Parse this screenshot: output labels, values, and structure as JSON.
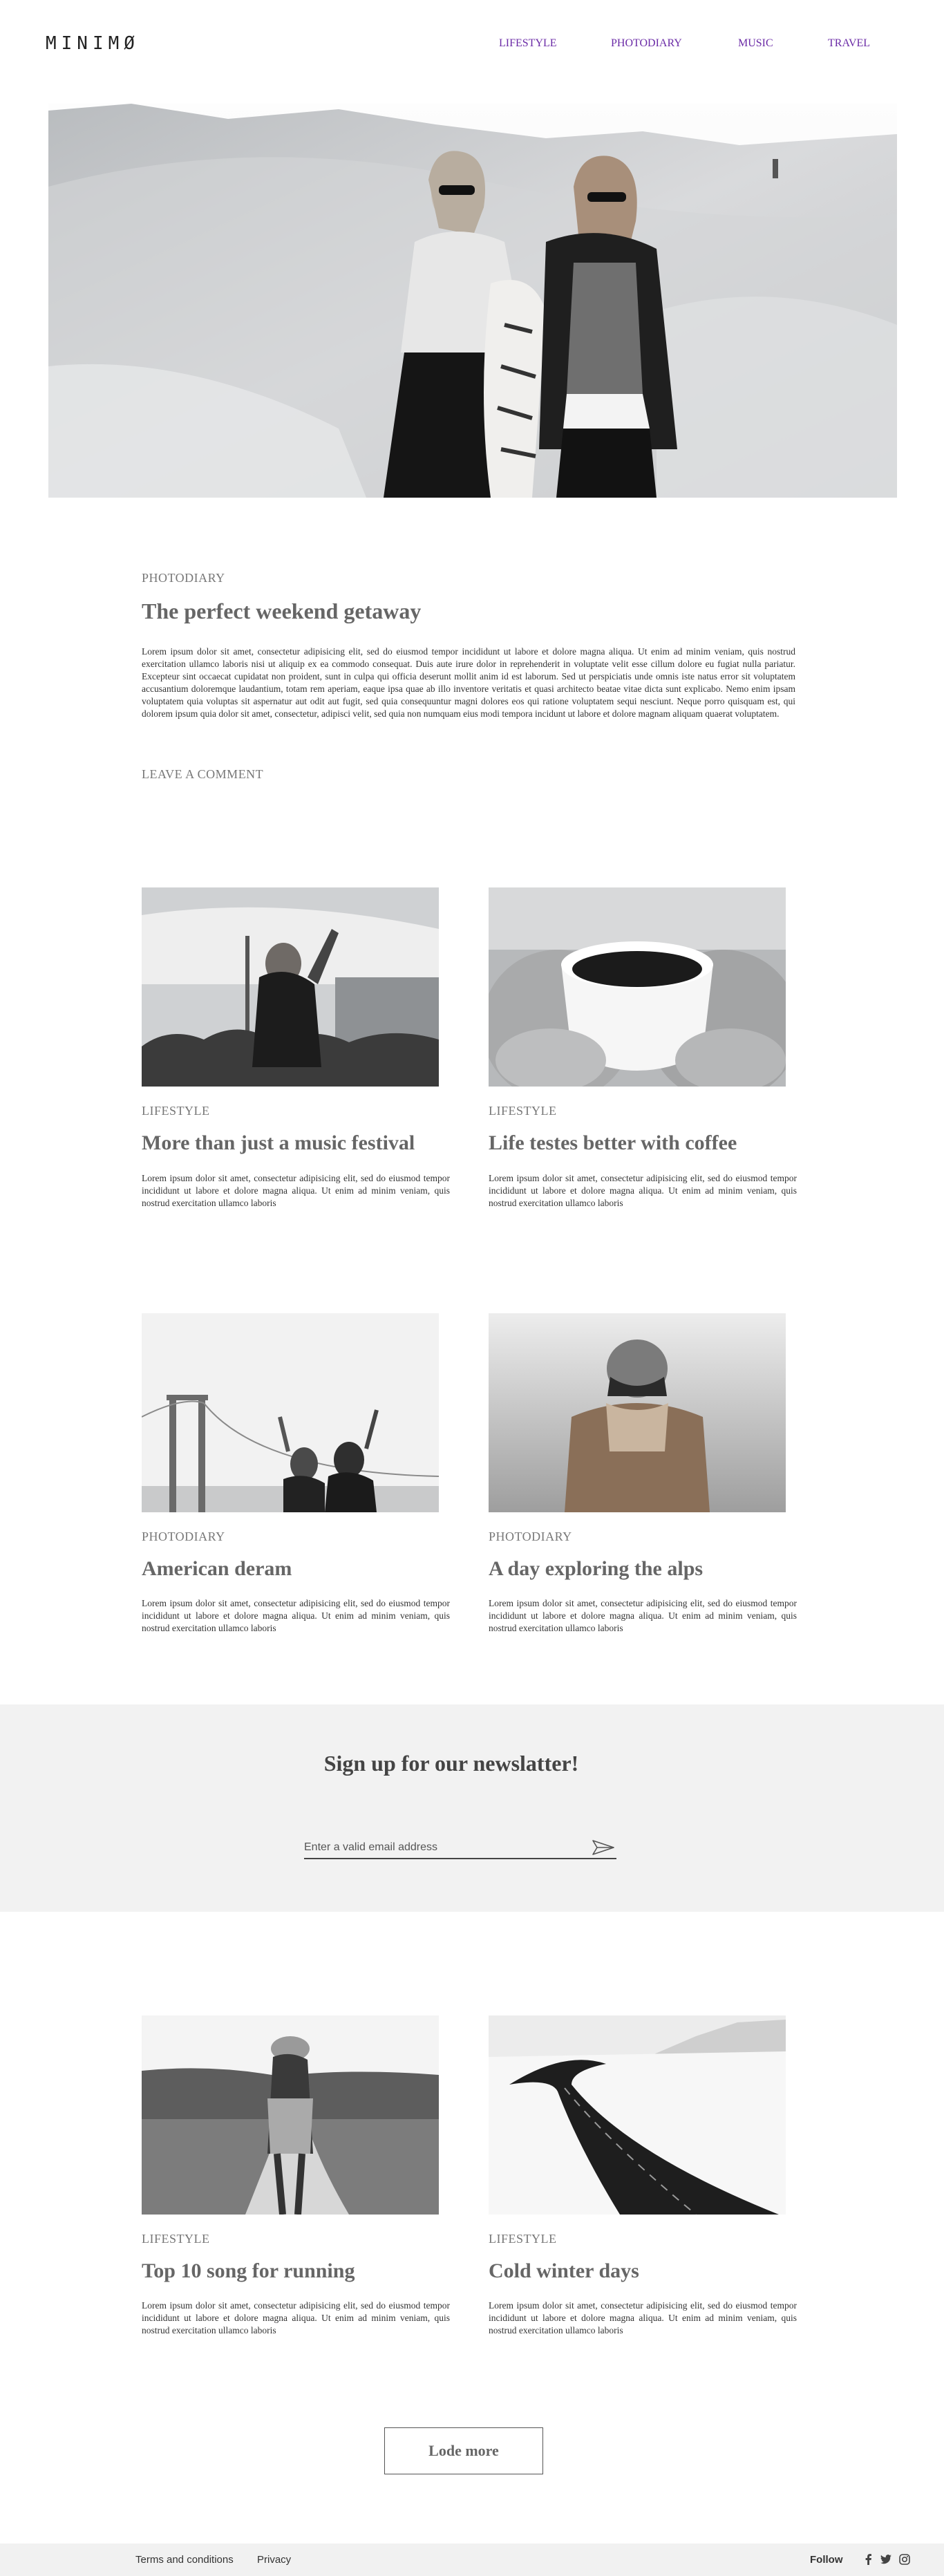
{
  "brand": {
    "logo": "MINIMØ"
  },
  "nav": [
    "LIFESTYLE",
    "PHOTODIARY",
    "MUSIC",
    "TRAVEL"
  ],
  "featured": {
    "category": "PHOTODIARY",
    "title": "The perfect weekend getaway",
    "body": "Lorem ipsum dolor sit amet, consectetur adipisicing elit, sed do eiusmod tempor incididunt ut labore et dolore magna aliqua. Ut enim ad minim veniam, quis nostrud exercitation ullamco laboris nisi ut aliquip ex ea commodo consequat. Duis aute irure dolor in reprehenderit in voluptate velit esse cillum dolore eu fugiat nulla pariatur. Excepteur sint occaecat cupidatat non proident, sunt in culpa qui officia deserunt mollit anim id est laborum. Sed ut perspiciatis unde omnis iste natus error sit voluptatem accusantium doloremque laudantium, totam rem aperiam, eaque ipsa quae ab illo inventore veritatis et quasi architecto beatae vitae dicta sunt explicabo. Nemo enim ipsam voluptatem quia voluptas sit aspernatur aut odit aut fugit, sed quia consequuntur magni dolores eos qui ratione voluptatem sequi nesciunt. Neque porro quisquam est, qui dolorem ipsum quia dolor sit amet, consectetur, adipisci velit, sed quia non numquam eius modi tempora incidunt ut labore et dolore magnam aliquam quaerat voluptatem.",
    "comment_link": "LEAVE A COMMENT"
  },
  "posts": [
    {
      "category": "LIFESTYLE",
      "title": "More than just a music festival",
      "excerpt": "Lorem ipsum dolor sit amet, consectetur adipisicing elit, sed do eiusmod tempor incididunt ut labore et dolore magna aliqua. Ut enim ad minim veniam, quis nostrud exercitation ullamco laboris"
    },
    {
      "category": "LIFESTYLE",
      "title": "Life testes better with coffee",
      "excerpt": "Lorem ipsum dolor sit amet, consectetur adipisicing elit, sed do eiusmod tempor incididunt ut labore et dolore magna aliqua. Ut enim ad minim veniam, quis nostrud exercitation ullamco laboris"
    },
    {
      "category": "PHOTODIARY",
      "title": "American deram",
      "excerpt": "Lorem ipsum dolor sit amet, consectetur adipisicing elit, sed do eiusmod tempor incididunt ut labore et dolore magna aliqua. Ut enim ad minim veniam, quis nostrud exercitation ullamco laboris"
    },
    {
      "category": "PHOTODIARY",
      "title": "A day exploring the alps",
      "excerpt": "Lorem ipsum dolor sit amet, consectetur adipisicing elit, sed do eiusmod tempor incididunt ut labore et dolore magna aliqua. Ut enim ad minim veniam, quis nostrud exercitation ullamco laboris"
    },
    {
      "category": "LIFESTYLE",
      "title": "Top 10 song for running",
      "excerpt": "Lorem ipsum dolor sit amet, consectetur adipisicing elit, sed do eiusmod tempor incididunt ut labore et dolore magna aliqua. Ut enim ad minim veniam, quis nostrud exercitation ullamco laboris"
    },
    {
      "category": "LIFESTYLE",
      "title": "Cold winter days",
      "excerpt": "Lorem ipsum dolor sit amet, consectetur adipisicing elit, sed do eiusmod tempor incididunt ut labore et dolore magna aliqua. Ut enim ad minim veniam, quis nostrud exercitation ullamco laboris"
    }
  ],
  "newsletter": {
    "title": "Sign up for our newslatter!",
    "placeholder": "Enter a valid email address"
  },
  "load_more": "Lode more",
  "footer": {
    "terms": "Terms and conditions",
    "privacy": "Privacy",
    "follow": "Follow"
  },
  "icons": {
    "send": "paper-plane-icon",
    "facebook": "facebook-icon",
    "twitter": "twitter-icon",
    "instagram": "instagram-icon"
  },
  "colors": {
    "nav": "#6a2aa6",
    "band": "#f2f2f2",
    "footer": "#f1f1f1"
  }
}
